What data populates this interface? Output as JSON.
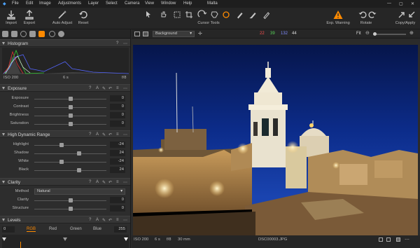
{
  "menu": [
    "File",
    "Edit",
    "Image",
    "Adjustments",
    "Layer",
    "Select",
    "Camera",
    "View",
    "Window",
    "Help"
  ],
  "window_title": "Malta",
  "toolbar": {
    "import": "Import",
    "export": "Export",
    "auto_adjust": "Auto Adjust",
    "reset": "Reset",
    "cursor_tools": "Cursor Tools",
    "exp_warning": "Exp. Warning",
    "rotate": "Rotate",
    "copy_apply": "Copy/Apply"
  },
  "histogram": {
    "title": "Histogram",
    "iso": "ISO 200",
    "shutter": "6 s",
    "aperture": "f/8"
  },
  "exposure": {
    "title": "Exposure",
    "rows": [
      {
        "label": "Exposure",
        "value": "0",
        "pos": 0.5
      },
      {
        "label": "Contrast",
        "value": "0",
        "pos": 0.5
      },
      {
        "label": "Brightness",
        "value": "0",
        "pos": 0.5
      },
      {
        "label": "Saturation",
        "value": "0",
        "pos": 0.5
      }
    ]
  },
  "hdr": {
    "title": "High Dynamic Range",
    "rows": [
      {
        "label": "Highlight",
        "value": "-24",
        "pos": 0.38
      },
      {
        "label": "Shadow",
        "value": "24",
        "pos": 0.62
      },
      {
        "label": "White",
        "value": "-24",
        "pos": 0.38
      },
      {
        "label": "Black",
        "value": "24",
        "pos": 0.62
      }
    ]
  },
  "clarity": {
    "title": "Clarity",
    "method_label": "Method",
    "method_value": "Natural",
    "rows": [
      {
        "label": "Clarity",
        "value": "0",
        "pos": 0.5
      },
      {
        "label": "Structure",
        "value": "0",
        "pos": 0.5
      }
    ]
  },
  "levels": {
    "title": "Levels",
    "min": "0",
    "max": "255",
    "channels": [
      "RGB",
      "Red",
      "Green",
      "Blue"
    ]
  },
  "viewer": {
    "style": "Background",
    "readout_r": "22",
    "readout_g": "39",
    "readout_b": "132",
    "readout_l": "44",
    "fit": "Fit",
    "foot_iso": "ISO 200",
    "foot_shutter": "6 s",
    "foot_aperture": "f/8",
    "foot_focal": "30 mm",
    "filename": "DSC00003.JPG"
  },
  "colors": {
    "accent": "#ff8a00",
    "sky": "#0c2c8a"
  }
}
